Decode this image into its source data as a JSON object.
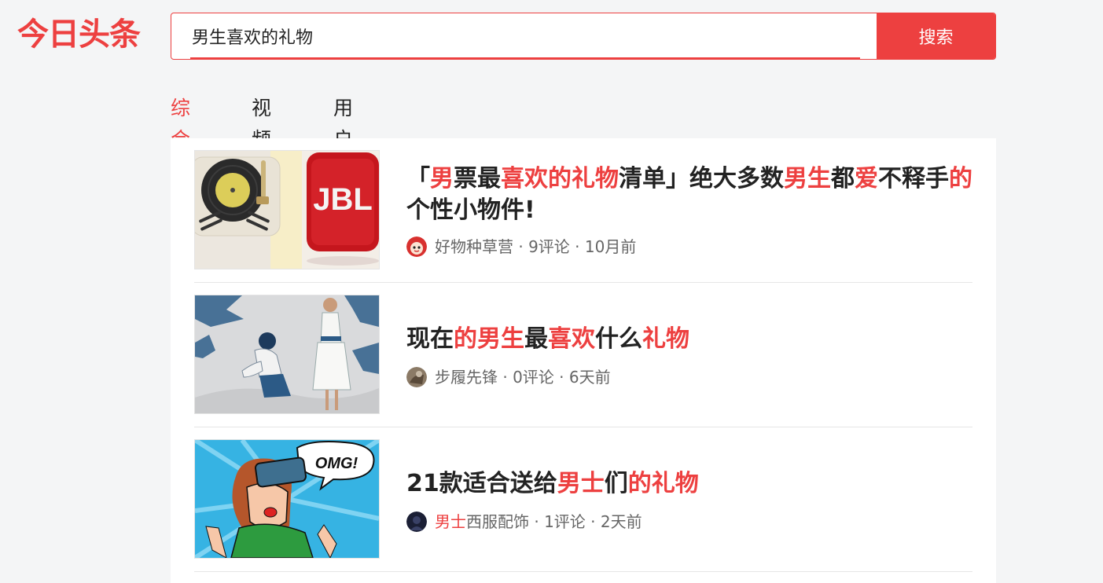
{
  "logo": "今日头条",
  "search": {
    "value": "男生喜欢的礼物",
    "button_label": "搜索"
  },
  "tabs": [
    {
      "label": "综合",
      "active": true
    },
    {
      "label": "视频",
      "active": false
    },
    {
      "label": "用户",
      "active": false
    }
  ],
  "results": [
    {
      "title_parts": [
        {
          "text": "「",
          "hl": false
        },
        {
          "text": "男",
          "hl": true
        },
        {
          "text": "票最",
          "hl": false
        },
        {
          "text": "喜欢的礼物",
          "hl": true
        },
        {
          "text": "清单」绝大多数",
          "hl": false
        },
        {
          "text": "男生",
          "hl": true
        },
        {
          "text": "都",
          "hl": false
        },
        {
          "text": "爱",
          "hl": true
        },
        {
          "text": "不释手",
          "hl": false
        },
        {
          "text": "的",
          "hl": true
        },
        {
          "text": "个性小物件!",
          "hl": false
        }
      ],
      "author": "好物种草营",
      "author_hl": "",
      "comments": "9评论",
      "time": "10月前",
      "thumb_text": "JBL",
      "thumb_icon": "record-player-and-speaker-image",
      "avatar_icon": "red-cartoon-avatar-icon"
    },
    {
      "title_parts": [
        {
          "text": "现在",
          "hl": false
        },
        {
          "text": "的男生",
          "hl": true
        },
        {
          "text": "最",
          "hl": false
        },
        {
          "text": "喜欢",
          "hl": true
        },
        {
          "text": "什么",
          "hl": false
        },
        {
          "text": "礼物",
          "hl": true
        }
      ],
      "author": "步履先锋",
      "author_hl": "",
      "comments": "0评论",
      "time": "6天前",
      "thumb_icon": "kneeling-man-proposal-illustration",
      "avatar_icon": "brown-avatar-icon"
    },
    {
      "title_parts": [
        {
          "text": "21款适合送给",
          "hl": false
        },
        {
          "text": "男士",
          "hl": true
        },
        {
          "text": "们",
          "hl": false
        },
        {
          "text": "的礼物",
          "hl": true
        }
      ],
      "author": "西服配饰",
      "author_hl": "男士",
      "comments": "1评论",
      "time": "2天前",
      "thumb_text": "OMG!",
      "thumb_icon": "vr-headset-pop-art-illustration",
      "avatar_icon": "dark-avatar-icon"
    }
  ],
  "meta_separator": "·",
  "colors": {
    "accent": "#ed4040",
    "page_bg": "#f4f5f6",
    "title": "#222222",
    "meta": "#666666"
  }
}
